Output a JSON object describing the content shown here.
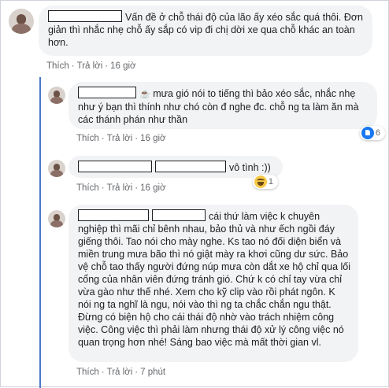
{
  "comments": [
    {
      "text": "Vấn đề ở chỗ thái độ của lão ấy xéo sắc quá thôi. Đơn giản thì nhắc nhẹ chỗ ấy sắp có vip đi chị dời xe qua chỗ khác an toàn hơn.",
      "like_label": "Thích",
      "reply_label": "Trả lời",
      "time": "16 giờ"
    },
    {
      "emoji": "☕",
      "text": "mưa gió nói to tiếng thì bảo xéo sắc, nhắc nhẹ như ý bạn thì thính như chó còn đ nghe đc. chỗ ng ta làm ăn mà các thánh phán như thần",
      "like_label": "Thích",
      "reply_label": "Trả lời",
      "time": "16 giờ",
      "reaction": {
        "icon": "like-icon",
        "count": "6"
      }
    },
    {
      "text": "vô tình :))",
      "like_label": "Thích",
      "reply_label": "Trả lời",
      "time": "16 giờ",
      "reaction": {
        "icon": "haha-icon",
        "count": "1"
      }
    },
    {
      "text": "cái thứ làm việc k chuyên nghiệp thì mãi chỉ bênh nhau, bảo thủ và như ếch ngồi đáy giếng thôi. Tao nói cho mày nghe. Ks tao nó đối diện biển và miền trung mưa bão thì nó giật mày ra khơi cũng dư sức. Bảo vệ chỗ tao thấy người đứng núp mưa còn dắt xe hộ chỉ qua lối cổng của nhân viên đứng tránh gió. Chứ k có chỉ tay vừa chỉ vừa gào như thế nhé. Xem cho kỹ clip vào rồi phát ngôn. K nói ng ta nghĩ là ngu, nói vào thì ng ta chắc chắn ngu thật. Đừng có biện hộ cho cái thái độ nhờ vào trách nhiệm công việc. Công việc thì phải làm nhưng thái độ xử lý công việc nó quan trọng hơn nhé! Sáng bao việc mà mất thời gian vl.",
      "like_label": "Thích",
      "reply_label": "Trả lời",
      "time": "7 phút"
    }
  ],
  "colors": {
    "thread_line": "#4b78c8",
    "bubble": "#f2f3f5",
    "meta": "#65676b"
  }
}
